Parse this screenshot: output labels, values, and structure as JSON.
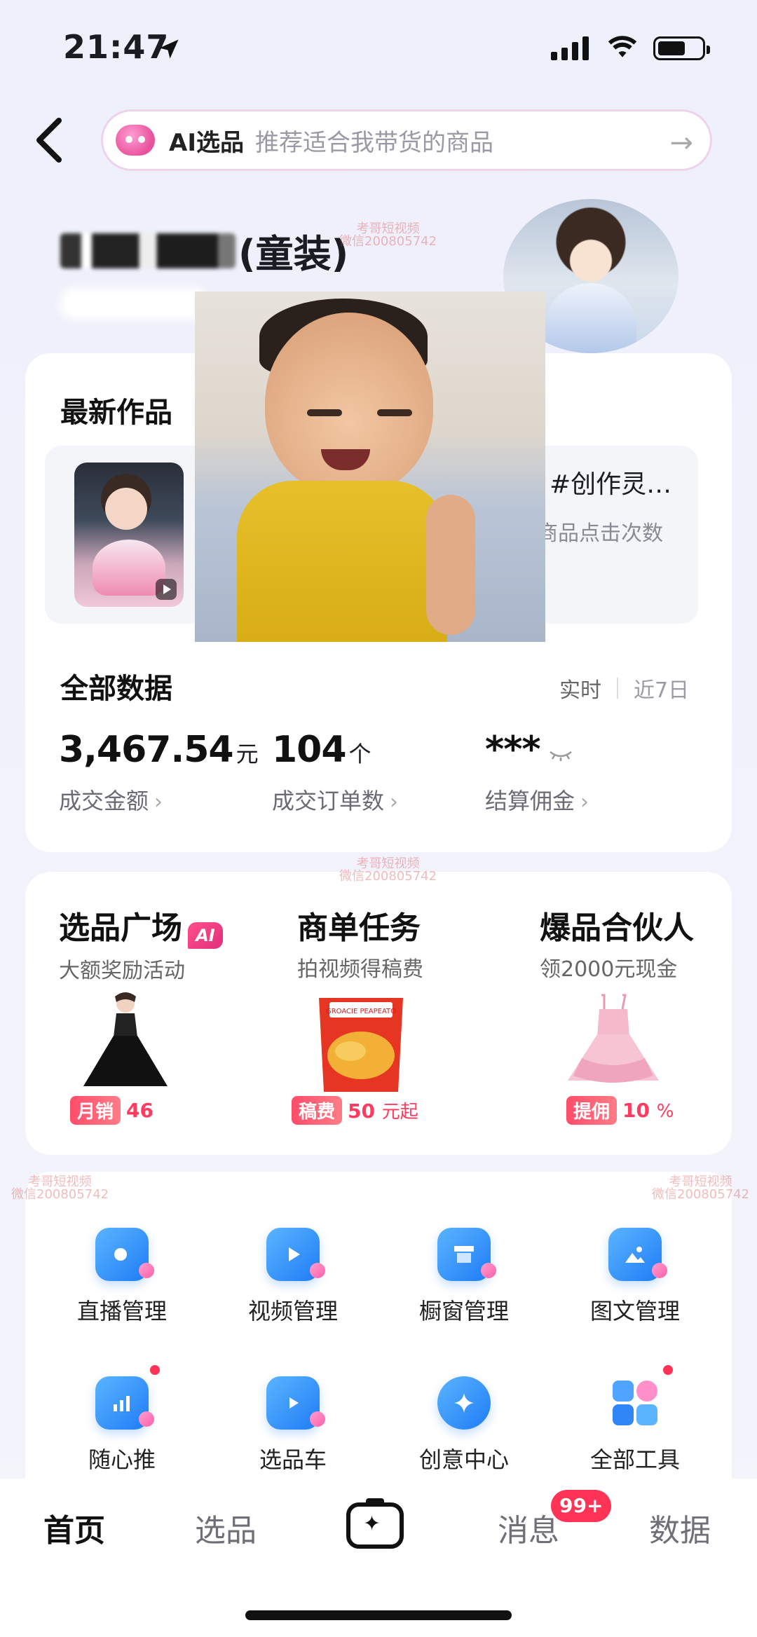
{
  "status_bar": {
    "time": "21:47"
  },
  "search": {
    "label": "AI选品",
    "placeholder": "推荐适合我带货的商品",
    "arrow": "→"
  },
  "profile": {
    "shop_name_suffix": "(童装)"
  },
  "latest_works": {
    "title": "最新作品",
    "tag": "#创作灵…",
    "meta": "商品点击次数"
  },
  "all_data": {
    "title": "全部数据",
    "tabs": [
      "实时",
      "近7日"
    ],
    "metrics": [
      {
        "value": "3,467.54",
        "unit": "元",
        "label": "成交金额"
      },
      {
        "value": "104",
        "unit": "个",
        "label": "成交订单数"
      },
      {
        "value": "***",
        "unit": "",
        "label": "结算佣金"
      }
    ]
  },
  "promos": [
    {
      "title": "选品广场",
      "badge": "AI",
      "sub": "大额奖励活动",
      "tag_key": "月销",
      "tag_value": "46",
      "tag_unit": ""
    },
    {
      "title": "商单任务",
      "sub": "拍视频得稿费",
      "tag_key": "稿费",
      "tag_value": "50",
      "tag_unit": "元起",
      "product_text": "GROACIE PEAPEATO"
    },
    {
      "title": "爆品合伙人",
      "sub": "领2000元现金",
      "tag_key": "提佣",
      "tag_value": "10",
      "tag_unit": "%"
    }
  ],
  "tools": [
    {
      "label": "直播管理",
      "icon": "live-camera-icon",
      "badge": false
    },
    {
      "label": "视频管理",
      "icon": "video-play-icon",
      "badge": false
    },
    {
      "label": "橱窗管理",
      "icon": "storefront-icon",
      "badge": false
    },
    {
      "label": "图文管理",
      "icon": "image-post-icon",
      "badge": false
    },
    {
      "label": "随心推",
      "icon": "promote-chart-icon",
      "badge": true
    },
    {
      "label": "选品车",
      "icon": "shopping-cart-play-icon",
      "badge": false
    },
    {
      "label": "创意中心",
      "icon": "creative-star-icon",
      "badge": false
    },
    {
      "label": "全部工具",
      "icon": "grid-tools-icon",
      "badge": true
    }
  ],
  "tabbar": {
    "items": [
      "首页",
      "选品",
      "消息",
      "数据"
    ],
    "message_badge": "99+"
  },
  "watermark": {
    "line1": "考哥短视频",
    "line2": "微信200805742"
  },
  "colors": {
    "accent": "#ff3356",
    "brand_blue": "#1f7cf5",
    "pink": "#ff5fa9"
  }
}
